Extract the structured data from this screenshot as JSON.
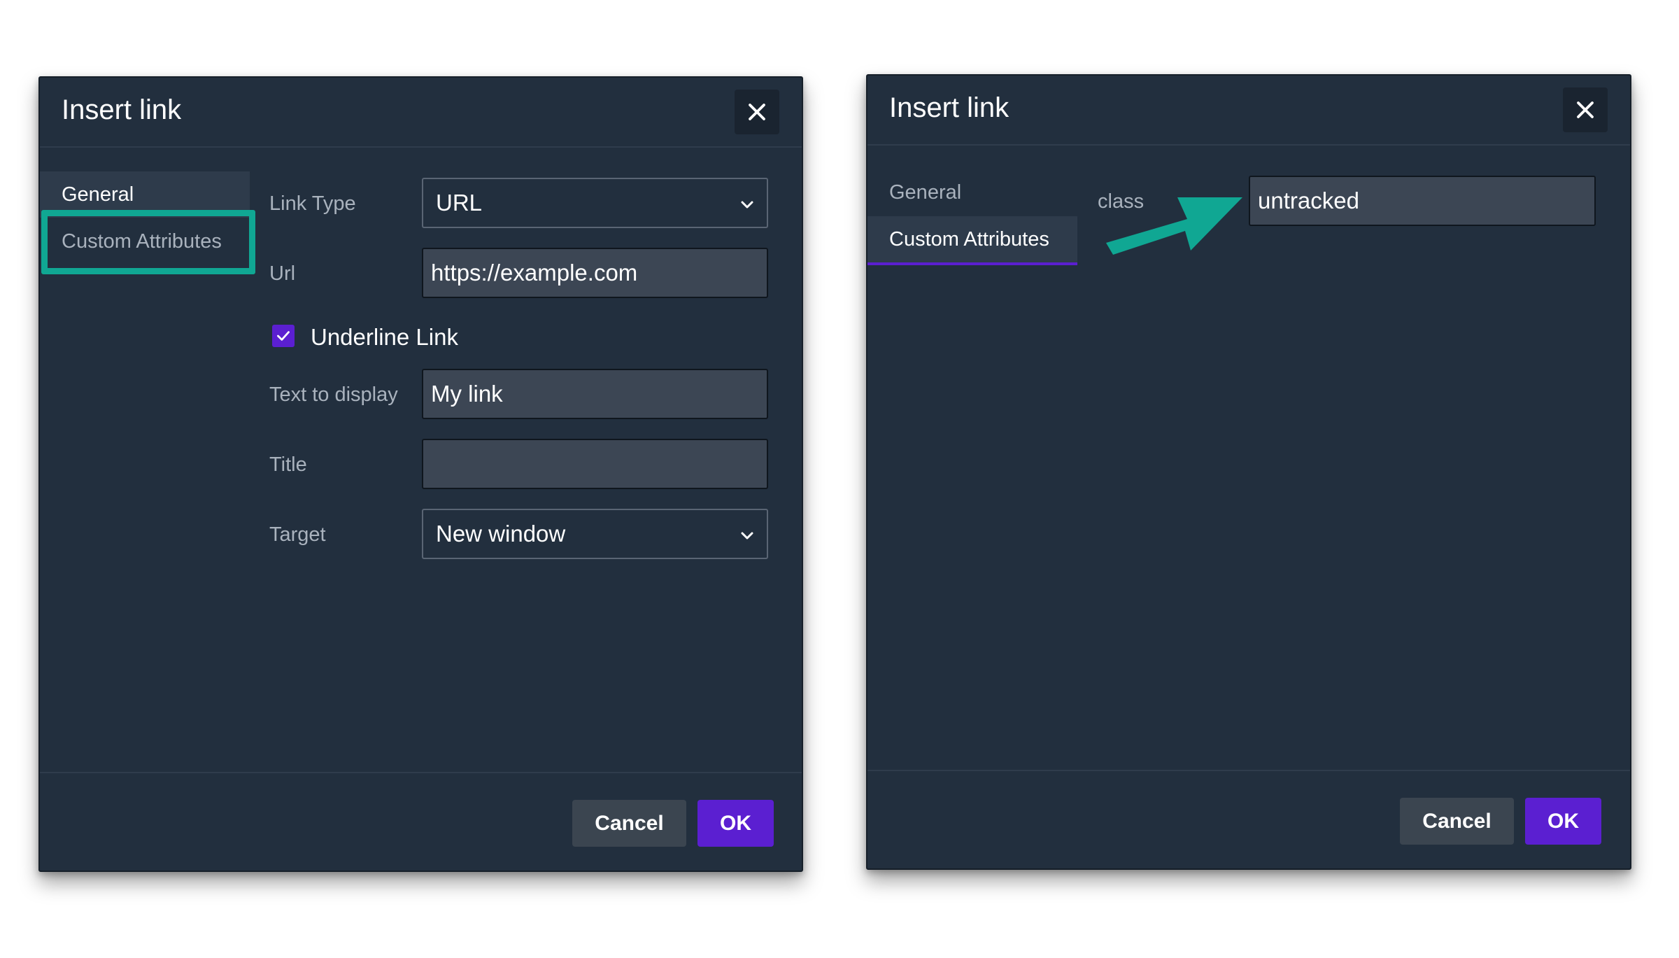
{
  "dialog_left": {
    "title": "Insert link",
    "tabs": [
      {
        "label": "General",
        "active": true
      },
      {
        "label": "Custom Attributes",
        "active": false,
        "highlighted": true
      }
    ],
    "fields": {
      "link_type_label": "Link Type",
      "link_type_value": "URL",
      "url_label": "Url",
      "url_value": "https://example.com",
      "underline_label": "Underline Link",
      "underline_checked": true,
      "text_label": "Text to display",
      "text_value": "My link",
      "title_label": "Title",
      "title_value": "",
      "target_label": "Target",
      "target_value": "New window"
    },
    "buttons": {
      "cancel": "Cancel",
      "ok": "OK"
    }
  },
  "dialog_right": {
    "title": "Insert link",
    "tabs": [
      {
        "label": "General",
        "active": false
      },
      {
        "label": "Custom Attributes",
        "active": true
      }
    ],
    "fields": {
      "class_label": "class",
      "class_value": "untracked"
    },
    "buttons": {
      "cancel": "Cancel",
      "ok": "OK"
    }
  },
  "colors": {
    "dialog_bg": "#222f3e",
    "accent": "#5b1fd1",
    "highlight": "#10a793",
    "input_bg": "#3c4654"
  },
  "icons": {
    "close": "close-icon",
    "dropdown": "chevron-down-icon",
    "checkbox": "check-icon",
    "annotation": "arrow-icon"
  }
}
